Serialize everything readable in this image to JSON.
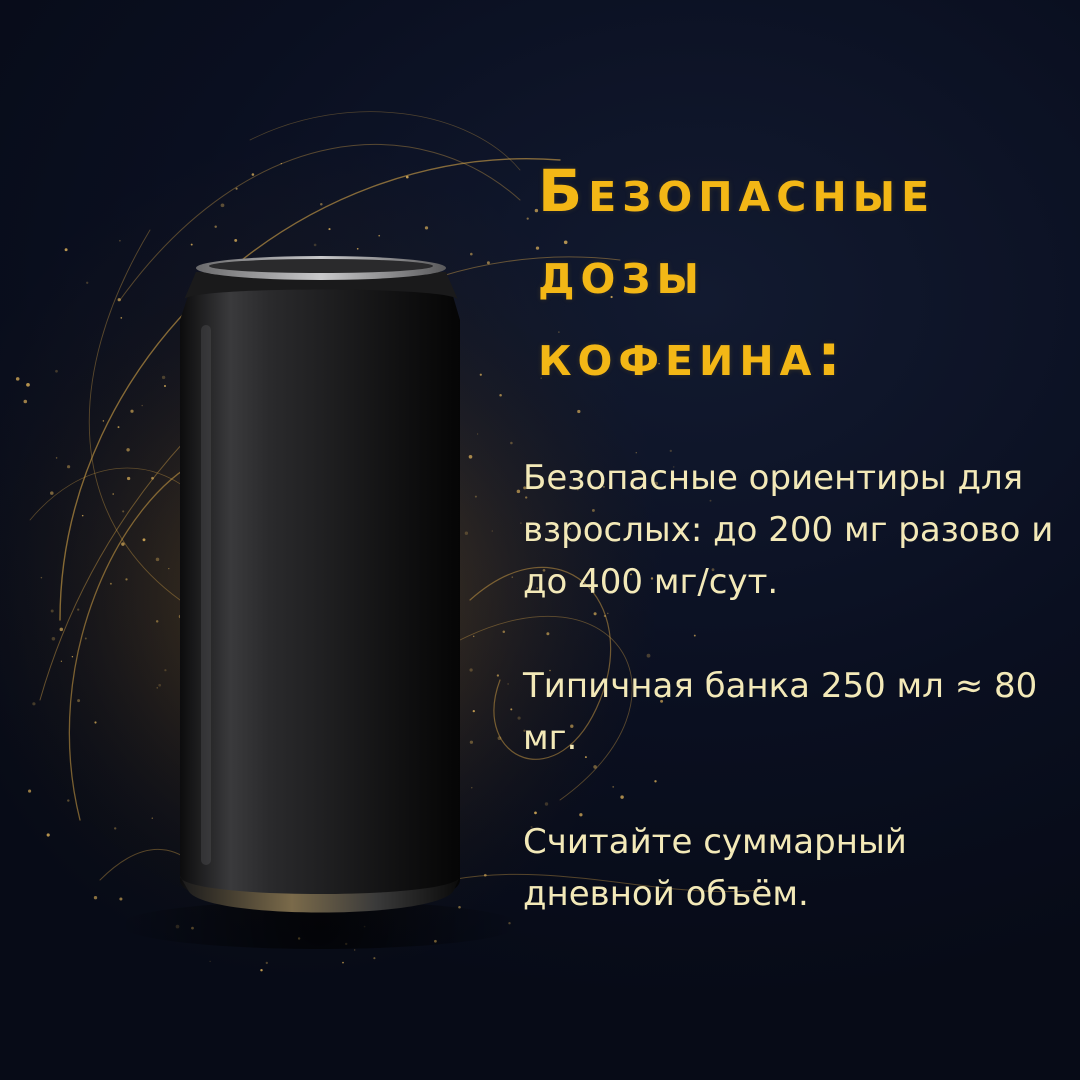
{
  "title_lines": [
    "Безопасные",
    "дозы",
    "кофеина:"
  ],
  "paragraphs": [
    "Безопасные ориентиры для взрослых: до 200 мг разово и до 400 мг/сут.",
    "Типичная банка 250 мл ≈ 80 мг.",
    "Считайте суммарный дневной объём."
  ],
  "colors": {
    "background": "#0b1122",
    "title": "#f3b716",
    "body_text": "#f3e9b8",
    "can": "#1c1c1e",
    "glow": "#e0a83a"
  }
}
